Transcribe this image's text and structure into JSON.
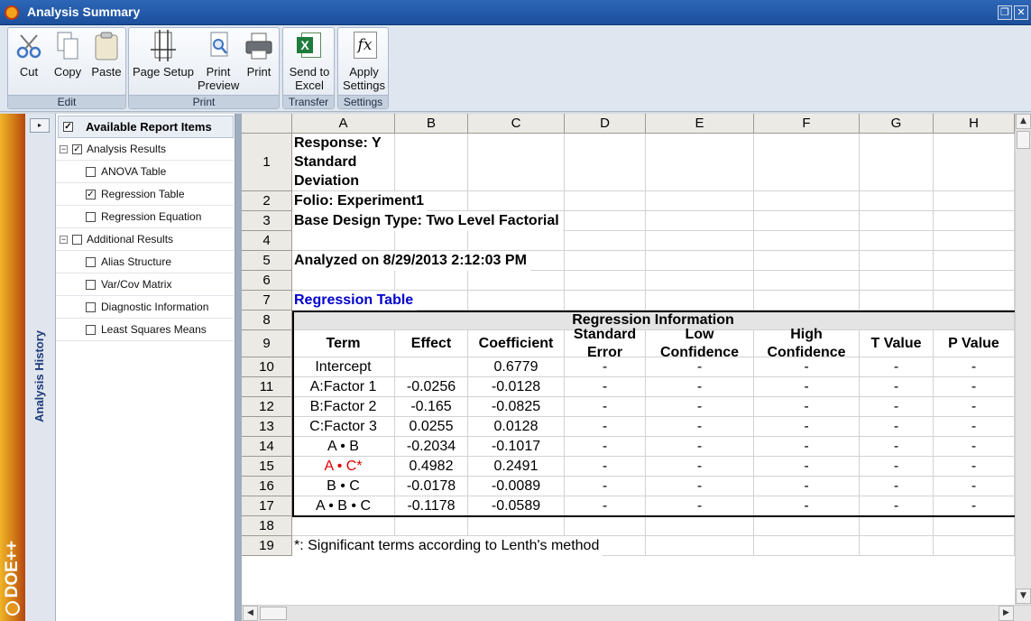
{
  "window": {
    "title": "Analysis Summary",
    "restore_glyph": "❐",
    "close_glyph": "✕"
  },
  "ribbon": {
    "groups": {
      "edit": "Edit",
      "print": "Print",
      "transfer": "Transfer",
      "settings": "Settings"
    },
    "cut": "Cut",
    "copy": "Copy",
    "paste": "Paste",
    "page_setup": "Page Setup",
    "print_preview_l1": "Print",
    "print_preview_l2": "Preview",
    "print": "Print",
    "send_excel_l1": "Send to",
    "send_excel_l2": "Excel",
    "apply_settings_l1": "Apply",
    "apply_settings_l2": "Settings",
    "icons": {
      "cut": "scissors-icon",
      "copy": "copy-icon",
      "paste": "paste-icon",
      "page_setup": "page-setup-icon",
      "print_preview": "print-preview-icon",
      "print": "printer-icon",
      "excel": "excel-icon",
      "fx": "fx-icon"
    },
    "excel_glyph": "X",
    "fx_glyph": "fx"
  },
  "brand": {
    "logo": "DOE++"
  },
  "history": {
    "label": "Analysis History",
    "collapse_glyph": "▸"
  },
  "tree": {
    "header": "Available Report Items",
    "check": "✓",
    "minus": "−",
    "items": [
      {
        "label": "Analysis Results",
        "checked": true
      },
      {
        "label": "ANOVA Table",
        "checked": false
      },
      {
        "label": "Regression Table",
        "checked": true
      },
      {
        "label": "Regression Equation",
        "checked": false
      },
      {
        "label": "Additional Results",
        "checked": false
      },
      {
        "label": "Alias Structure",
        "checked": false
      },
      {
        "label": "Var/Cov Matrix",
        "checked": false
      },
      {
        "label": "Diagnostic Information",
        "checked": false
      },
      {
        "label": "Least Squares Means",
        "checked": false
      }
    ]
  },
  "sheet": {
    "columns": [
      "A",
      "B",
      "C",
      "D",
      "E",
      "F",
      "G",
      "H"
    ],
    "rows": [
      "1",
      "2",
      "3",
      "4",
      "5",
      "6",
      "7",
      "8",
      "9",
      "10",
      "11",
      "12",
      "13",
      "14",
      "15",
      "16",
      "17",
      "18",
      "19"
    ],
    "r1_line1": "Response: Y",
    "r1_line2": "Standard",
    "r1_line3": "Deviation",
    "folio": "Folio: Experiment1",
    "design": "Base Design Type: Two Level Factorial",
    "analyzed": "Analyzed on 8/29/2013 2:12:03 PM",
    "table_title": "Regression Table",
    "table_header": "Regression Information",
    "headers": {
      "term": "Term",
      "effect": "Effect",
      "coefficient": "Coefficient",
      "se_1": "Standard",
      "se_2": "Error",
      "low_1": "Low",
      "low_2": "Confidence",
      "high_1": "High",
      "high_2": "Confidence",
      "t": "T Value",
      "p": "P Value"
    },
    "data": [
      {
        "term": "Intercept",
        "effect": "",
        "coef": "0.6779",
        "se": "-",
        "low": "-",
        "high": "-",
        "t": "-",
        "p": "-",
        "significant": false
      },
      {
        "term": "A:Factor 1",
        "effect": "-0.0256",
        "coef": "-0.0128",
        "se": "-",
        "low": "-",
        "high": "-",
        "t": "-",
        "p": "-",
        "significant": false
      },
      {
        "term": "B:Factor 2",
        "effect": "-0.165",
        "coef": "-0.0825",
        "se": "-",
        "low": "-",
        "high": "-",
        "t": "-",
        "p": "-",
        "significant": false
      },
      {
        "term": "C:Factor 3",
        "effect": "0.0255",
        "coef": "0.0128",
        "se": "-",
        "low": "-",
        "high": "-",
        "t": "-",
        "p": "-",
        "significant": false
      },
      {
        "term": "A • B",
        "effect": "-0.2034",
        "coef": "-0.1017",
        "se": "-",
        "low": "-",
        "high": "-",
        "t": "-",
        "p": "-",
        "significant": false
      },
      {
        "term": "A • C*",
        "effect": "0.4982",
        "coef": "0.2491",
        "se": "-",
        "low": "-",
        "high": "-",
        "t": "-",
        "p": "-",
        "significant": true
      },
      {
        "term": "B • C",
        "effect": "-0.0178",
        "coef": "-0.0089",
        "se": "-",
        "low": "-",
        "high": "-",
        "t": "-",
        "p": "-",
        "significant": false
      },
      {
        "term": "A • B • C",
        "effect": "-0.1178",
        "coef": "-0.0589",
        "se": "-",
        "low": "-",
        "high": "-",
        "t": "-",
        "p": "-",
        "significant": false
      }
    ],
    "footnote": "*: Significant terms according to Lenth's method",
    "colors": {
      "link": "#0000cc",
      "significant": "#dd0000",
      "header_fill": "#e4e4e4"
    },
    "scroll": {
      "up": "▲",
      "down": "▼",
      "left": "◀",
      "right": "▶"
    }
  }
}
